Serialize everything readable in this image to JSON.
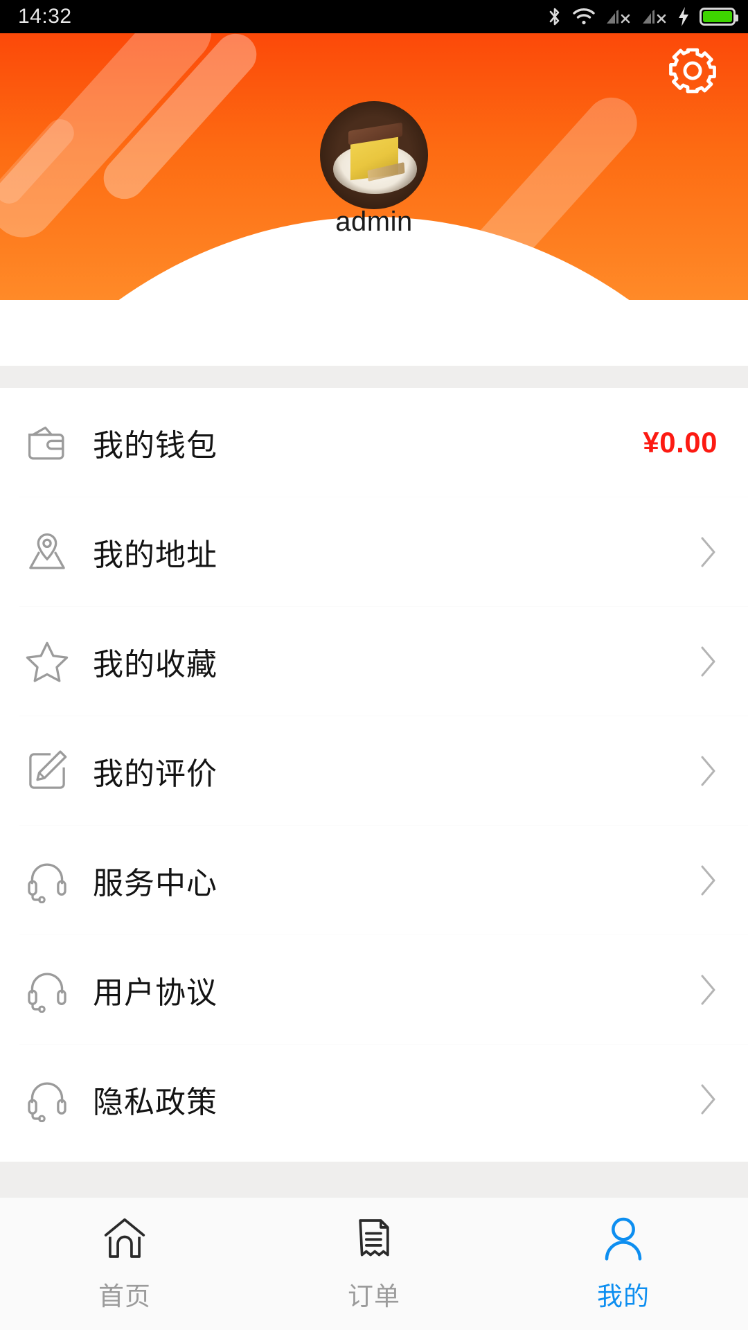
{
  "status_bar": {
    "time": "14:32",
    "icons": [
      "bluetooth-icon",
      "wifi-icon",
      "signal-1-no-sim-icon",
      "signal-2-no-sim-icon",
      "charging-bolt-icon",
      "battery-icon"
    ],
    "battery_color": "#3ed400"
  },
  "header": {
    "settings_icon": "gear-icon",
    "avatar_alt": "cake-photo-avatar",
    "username": "admin",
    "gradient_from": "#fc4909",
    "gradient_to": "#ff8a28"
  },
  "menu": {
    "items": [
      {
        "icon": "wallet-icon",
        "label": "我的钱包",
        "value": "¥0.00",
        "value_color": "#fc1a12",
        "has_chevron": false
      },
      {
        "icon": "map-pin-icon",
        "label": "我的地址",
        "value": "",
        "has_chevron": true
      },
      {
        "icon": "star-icon",
        "label": "我的收藏",
        "value": "",
        "has_chevron": true
      },
      {
        "icon": "pencil-square-icon",
        "label": "我的评价",
        "value": "",
        "has_chevron": true
      },
      {
        "icon": "headset-icon",
        "label": "服务中心",
        "value": "",
        "has_chevron": true
      },
      {
        "icon": "headset-icon",
        "label": "用户协议",
        "value": "",
        "has_chevron": true
      },
      {
        "icon": "headset-icon",
        "label": "隐私政策",
        "value": "",
        "has_chevron": true
      }
    ]
  },
  "tabbar": {
    "active_color": "#0d8ef0",
    "inactive_color": "#9b9b9b",
    "tabs": [
      {
        "icon": "home-icon",
        "label": "首页",
        "active": false
      },
      {
        "icon": "receipt-icon",
        "label": "订单",
        "active": false
      },
      {
        "icon": "person-icon",
        "label": "我的",
        "active": true
      }
    ]
  }
}
